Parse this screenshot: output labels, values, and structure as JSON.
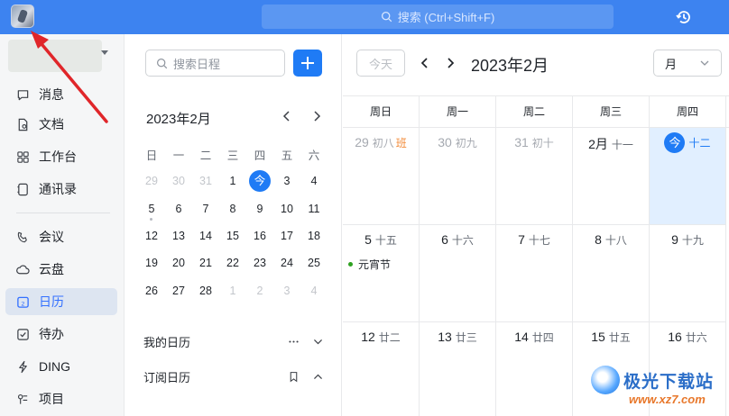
{
  "topbar": {
    "search_placeholder": "搜索 (Ctrl+Shift+F)",
    "accent": "#3d83f0"
  },
  "nav": {
    "items": [
      {
        "label": "消息",
        "icon": "message-icon"
      },
      {
        "label": "文档",
        "icon": "docs-icon"
      },
      {
        "label": "工作台",
        "icon": "workbench-icon"
      },
      {
        "label": "通讯录",
        "icon": "contacts-icon"
      },
      {
        "label": "会议",
        "icon": "meeting-icon"
      },
      {
        "label": "云盘",
        "icon": "cloud-icon"
      },
      {
        "label": "日历",
        "icon": "calendar-icon",
        "active": true
      },
      {
        "label": "待办",
        "icon": "todo-icon"
      },
      {
        "label": "DING",
        "icon": "ding-icon"
      },
      {
        "label": "项目",
        "icon": "project-icon"
      }
    ]
  },
  "panel": {
    "search_placeholder": "搜索日程",
    "mini_title": "2023年2月",
    "weekdays": [
      "日",
      "一",
      "二",
      "三",
      "四",
      "五",
      "六"
    ],
    "weeks": [
      [
        "29",
        "30",
        "31",
        "1",
        "今",
        "3",
        "4"
      ],
      [
        "5",
        "6",
        "7",
        "8",
        "9",
        "10",
        "11"
      ],
      [
        "12",
        "13",
        "14",
        "15",
        "16",
        "17",
        "18"
      ],
      [
        "19",
        "20",
        "21",
        "22",
        "23",
        "24",
        "25"
      ],
      [
        "26",
        "27",
        "28",
        "1",
        "2",
        "3",
        "4"
      ]
    ],
    "my_calendar": "我的日历",
    "subscribed_calendar": "订阅日历"
  },
  "main": {
    "today_btn": "今天",
    "title": "2023年2月",
    "view": "月",
    "weekdays": [
      "周日",
      "周一",
      "周二",
      "周三",
      "周四"
    ],
    "rows": [
      [
        {
          "day": "29",
          "lunar": "初八",
          "tag": "班",
          "other": true
        },
        {
          "day": "30",
          "lunar": "初九",
          "other": true
        },
        {
          "day": "31",
          "lunar": "初十",
          "other": true
        },
        {
          "day": "2月",
          "lunar": "十一"
        },
        {
          "day": "今",
          "lunar": "十二",
          "today": true
        }
      ],
      [
        {
          "day": "5",
          "lunar": "十五",
          "event": "元宵节"
        },
        {
          "day": "6",
          "lunar": "十六"
        },
        {
          "day": "7",
          "lunar": "十七"
        },
        {
          "day": "8",
          "lunar": "十八"
        },
        {
          "day": "9",
          "lunar": "十九"
        }
      ],
      [
        {
          "day": "12",
          "lunar": "廿二"
        },
        {
          "day": "13",
          "lunar": "廿三"
        },
        {
          "day": "14",
          "lunar": "廿四"
        },
        {
          "day": "15",
          "lunar": "廿五"
        },
        {
          "day": "16",
          "lunar": "廿六"
        }
      ]
    ]
  },
  "watermark": {
    "title": "极光下载站",
    "url": "www.xz7.com"
  }
}
